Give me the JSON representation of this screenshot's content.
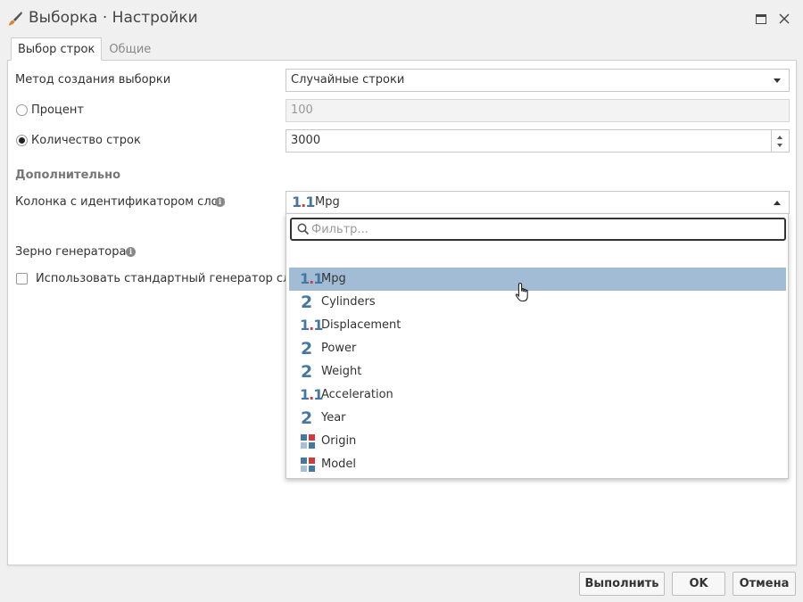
{
  "window": {
    "title": "Выборка · Настройки",
    "icon": "brush-icon"
  },
  "tabs": [
    {
      "label": "Выбор строк",
      "active": true
    },
    {
      "label": "Общие",
      "active": false
    }
  ],
  "form": {
    "method_label": "Метод создания выборки",
    "method_value": "Случайные строки",
    "percent_label": "Процент",
    "percent_value": "100",
    "percent_selected": false,
    "rows_label": "Количество строк",
    "rows_value": "3000",
    "rows_selected": true,
    "additional_heading": "Дополнительно",
    "layer_column_label": "Колонка с идентификатором слоя",
    "layer_column_value": "Mpg",
    "seed_label": "Зерно генератора",
    "std_generator_label": "Использовать стандартный генератор случа",
    "std_generator_checked": false
  },
  "dropdown": {
    "filter_placeholder": "Фильтр...",
    "options": [
      {
        "label": "Mpg",
        "type": "decimal",
        "highlighted": true
      },
      {
        "label": "Cylinders",
        "type": "integer",
        "highlighted": false
      },
      {
        "label": "Displacement",
        "type": "decimal",
        "highlighted": false
      },
      {
        "label": "Power",
        "type": "integer",
        "highlighted": false
      },
      {
        "label": "Weight",
        "type": "integer",
        "highlighted": false
      },
      {
        "label": "Acceleration",
        "type": "decimal",
        "highlighted": false
      },
      {
        "label": "Year",
        "type": "integer",
        "highlighted": false
      },
      {
        "label": "Origin",
        "type": "category",
        "highlighted": false
      },
      {
        "label": "Model",
        "type": "category",
        "highlighted": false
      }
    ]
  },
  "type_glyphs": {
    "decimal": "1.1",
    "integer": "2"
  },
  "buttons": {
    "run": "Выполнить",
    "ok": "OK",
    "cancel": "Отмена"
  },
  "colors": {
    "accent_blue": "#4677a0",
    "accent_red": "#d03c3c",
    "highlight": "#a2bcd6"
  }
}
